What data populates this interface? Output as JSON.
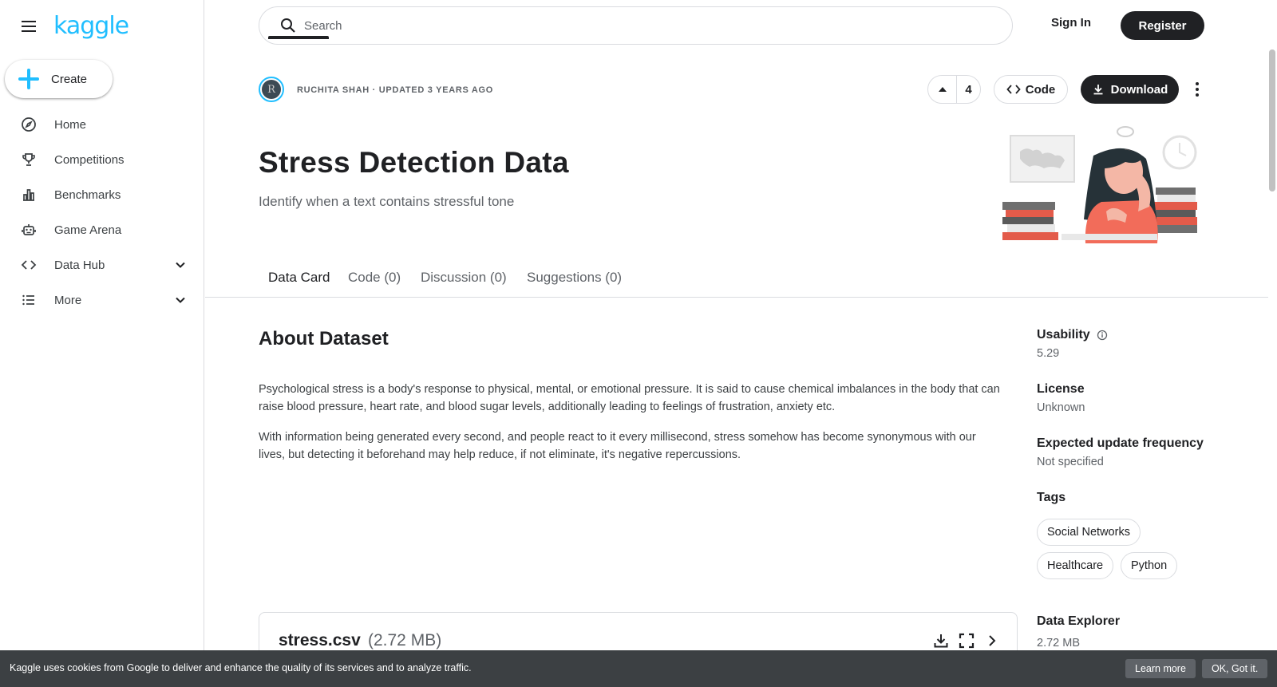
{
  "app": {
    "logo_text": "kaggle",
    "brand_color": "#20beff"
  },
  "sidebar": {
    "create_label": "Create",
    "items": [
      {
        "label": "Home",
        "icon": "compass-icon"
      },
      {
        "label": "Competitions",
        "icon": "trophy-icon"
      },
      {
        "label": "Benchmarks",
        "icon": "bar-chart-icon"
      },
      {
        "label": "Game Arena",
        "icon": "robot-icon"
      },
      {
        "label": "Data Hub",
        "icon": "code-brackets-icon",
        "expandable": true
      },
      {
        "label": "More",
        "icon": "list-icon",
        "expandable": true
      }
    ]
  },
  "header": {
    "search_placeholder": "Search",
    "sign_in": "Sign In",
    "register": "Register"
  },
  "dataset": {
    "avatar_initial": "R",
    "owner_line": "RUCHITA SHAH · UPDATED 3 YEARS AGO",
    "vote_count": "4",
    "code_label": "Code",
    "download_label": "Download",
    "title": "Stress Detection Data",
    "subtitle": "Identify when a text contains stressful tone"
  },
  "tabs": [
    {
      "label": "Data Card",
      "active": true
    },
    {
      "label": "Code (0)"
    },
    {
      "label": "Discussion (0)"
    },
    {
      "label": "Suggestions (0)"
    }
  ],
  "about": {
    "heading": "About Dataset",
    "paragraphs": [
      "Psychological stress is a body's response to physical, mental, or emotional pressure. It is said to cause chemical imbalances in the body that can raise blood pressure, heart rate, and blood sugar levels, additionally leading to feelings of frustration, anxiety etc.",
      "With information being generated every second, and people react to it every millisecond, stress somehow has become synonymous with our lives, but detecting it beforehand may help reduce, if not eliminate, it's negative repercussions."
    ]
  },
  "rail": {
    "usability_label": "Usability",
    "usability_value": "5.29",
    "license_label": "License",
    "license_value": "Unknown",
    "update_label": "Expected update frequency",
    "update_value": "Not specified",
    "tags_label": "Tags",
    "tags": [
      "Social Networks",
      "Healthcare",
      "Python"
    ],
    "explorer_label": "Data Explorer",
    "explorer_value": "2.72 MB"
  },
  "file": {
    "name": "stress.csv",
    "size": "(2.72 MB)"
  },
  "cookie": {
    "text": "Kaggle uses cookies from Google to deliver and enhance the quality of its services and to analyze traffic.",
    "learn_more": "Learn more",
    "ok": "OK, Got it."
  }
}
